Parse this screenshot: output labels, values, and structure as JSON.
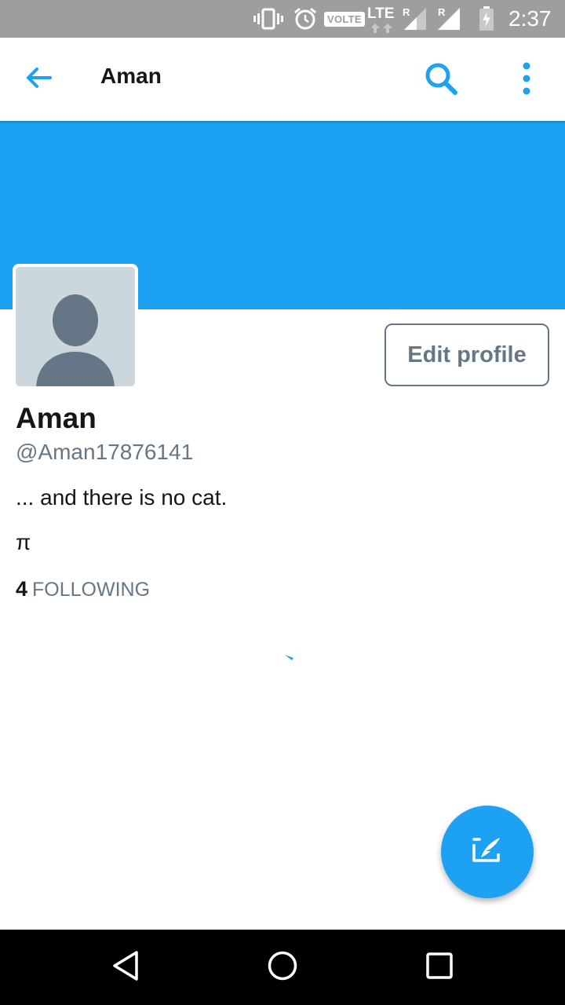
{
  "status_bar": {
    "volte": "VOLTE",
    "lte": "LTE",
    "roaming_1": "R",
    "roaming_2": "R",
    "time": "2:37",
    "icons": [
      "vibrate-icon",
      "alarm-icon",
      "signal-icon",
      "battery-charging-icon"
    ]
  },
  "app_bar": {
    "title": "Aman",
    "back_icon": "arrow-left-icon",
    "search_icon": "search-icon",
    "more_icon": "more-vertical-icon"
  },
  "profile": {
    "display_name": "Aman",
    "handle": "@Aman17876141",
    "bio_line_1": "... and there is no cat.",
    "bio_line_2": "π",
    "following_count": "4",
    "following_label": "FOLLOWING",
    "edit_button_label": "Edit profile"
  },
  "fab": {
    "icon": "compose-tweet-icon"
  },
  "nav_bar": {
    "icons": [
      "back-triangle-icon",
      "home-circle-icon",
      "recents-square-icon"
    ]
  },
  "colors": {
    "brand_blue": "#1da1f2",
    "secondary_text": "#657786",
    "primary_text": "#14171a",
    "status_bar": "#9e9e9e",
    "avatar_bg": "#ccd6dd",
    "avatar_figure": "#657786"
  }
}
